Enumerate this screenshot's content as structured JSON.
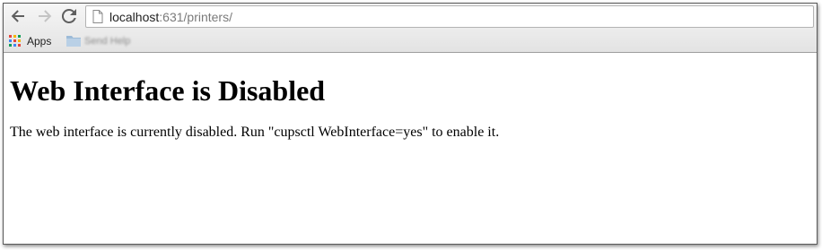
{
  "address_bar": {
    "url_host": "localhost",
    "url_rest": ":631/printers/"
  },
  "bookmarks": {
    "apps_label": "Apps",
    "items": [
      {
        "label": "Send Help"
      }
    ]
  },
  "page": {
    "heading": "Web Interface is Disabled",
    "body": "The web interface is currently disabled. Run \"cupsctl WebInterface=yes\" to enable it."
  },
  "icons": {
    "back": "arrow-left-icon",
    "forward": "arrow-right-icon",
    "reload": "reload-icon",
    "page": "page-icon",
    "apps": "apps-grid-icon",
    "folder": "folder-icon"
  },
  "colors": {
    "toolbar_top": "#f6f6f6",
    "toolbar_bottom": "#e3e3e3",
    "apps_red": "#e8453c",
    "apps_yellow": "#f4b400",
    "apps_green": "#0f9d58",
    "apps_blue": "#4285f4"
  }
}
